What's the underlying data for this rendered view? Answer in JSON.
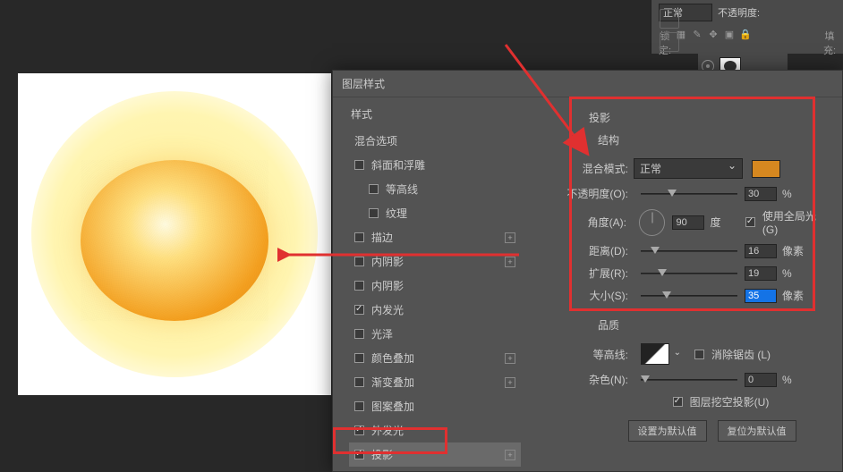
{
  "top_panel": {
    "blend_mode": "正常",
    "opacity_label": "不透明度:",
    "lock_label": "锁定:",
    "fill_label": "填充:"
  },
  "sidebar_style_title": "样式",
  "blend_options_label": "混合选项",
  "styles": {
    "bevel": {
      "label": "斜面和浮雕",
      "checked": false
    },
    "contour_sub": {
      "label": "等高线",
      "checked": false
    },
    "texture_sub": {
      "label": "纹理",
      "checked": false
    },
    "stroke": {
      "label": "描边",
      "checked": false
    },
    "inner_shadow1": {
      "label": "内阴影",
      "checked": false
    },
    "inner_shadow2": {
      "label": "内阴影",
      "checked": false
    },
    "inner_glow": {
      "label": "内发光",
      "checked": true
    },
    "satin": {
      "label": "光泽",
      "checked": false
    },
    "color_overlay": {
      "label": "颜色叠加",
      "checked": false
    },
    "gradient_overlay": {
      "label": "渐变叠加",
      "checked": false
    },
    "pattern_overlay": {
      "label": "图案叠加",
      "checked": false
    },
    "outer_glow": {
      "label": "外发光",
      "checked": true
    },
    "drop_shadow": {
      "label": "投影",
      "checked": true
    }
  },
  "dialog_title": "图层样式",
  "panel": {
    "title": "投影",
    "structure": "结构",
    "blend_mode_label": "混合模式:",
    "blend_mode_value": "正常",
    "opacity_label": "不透明度(O):",
    "opacity_value": "30",
    "opacity_unit": "%",
    "angle_label": "角度(A):",
    "angle_value": "90",
    "angle_unit": "度",
    "global_light_label": "使用全局光 (G)",
    "distance_label": "距离(D):",
    "distance_value": "16",
    "distance_unit": "像素",
    "spread_label": "扩展(R):",
    "spread_value": "19",
    "spread_unit": "%",
    "size_label": "大小(S):",
    "size_value": "35",
    "size_unit": "像素",
    "quality": "品质",
    "contour_label": "等高线:",
    "antialias_label": "消除锯齿 (L)",
    "noise_label": "杂色(N):",
    "noise_value": "0",
    "noise_unit": "%",
    "knockout_label": "图层挖空投影(U)",
    "default_btn": "设置为默认值",
    "reset_btn": "复位为默认值"
  }
}
